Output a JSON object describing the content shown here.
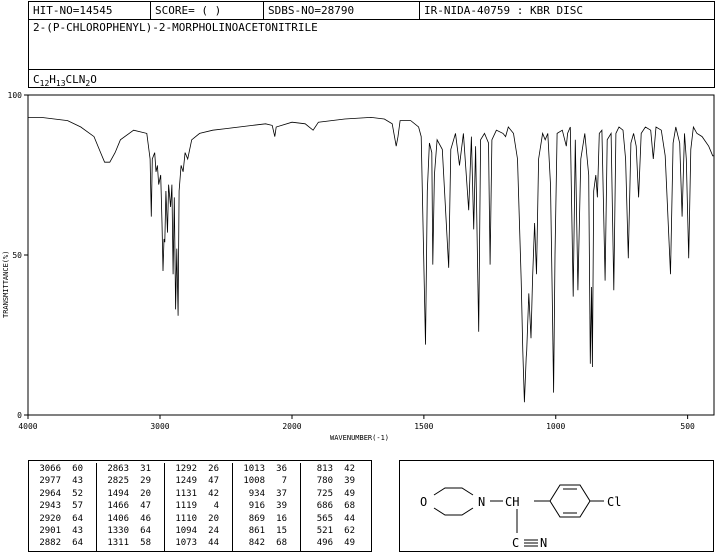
{
  "header": {
    "hit_no": "HIT-NO=14545",
    "score": "SCORE=  (  )",
    "sdbs_no": "SDBS-NO=28790",
    "ir_info": "IR-NIDA-40759 : KBR DISC"
  },
  "compound_name": "2-(P-CHLOROPHENYL)-2-MORPHOLINOACETONITRILE",
  "formula": {
    "c": "C",
    "c_n": "12",
    "h": "H",
    "h_n": "13",
    "cl": "CL",
    "n": "N",
    "n_n": "2",
    "o": "O"
  },
  "chart_data": {
    "type": "line",
    "xlabel": "WAVENUMBER(-1)",
    "ylabel": "TRANSMITTANCE(%)",
    "xlim": [
      4000,
      400
    ],
    "ylim": [
      0,
      100
    ],
    "x_ticks": [
      4000,
      3000,
      2000,
      1500,
      1000,
      500
    ],
    "y_ticks": [
      0,
      50,
      100
    ],
    "grid": false,
    "series": [
      {
        "values": [
          [
            4000,
            93
          ],
          [
            3900,
            93
          ],
          [
            3800,
            92.5
          ],
          [
            3700,
            92
          ],
          [
            3600,
            90
          ],
          [
            3500,
            87
          ],
          [
            3450,
            82
          ],
          [
            3420,
            79
          ],
          [
            3380,
            79
          ],
          [
            3340,
            82
          ],
          [
            3300,
            86
          ],
          [
            3200,
            89
          ],
          [
            3100,
            88
          ],
          [
            3075,
            80
          ],
          [
            3066,
            62
          ],
          [
            3058,
            80
          ],
          [
            3040,
            82
          ],
          [
            3030,
            76
          ],
          [
            3020,
            78
          ],
          [
            3010,
            72
          ],
          [
            2995,
            75
          ],
          [
            2985,
            60
          ],
          [
            2977,
            45
          ],
          [
            2970,
            55
          ],
          [
            2964,
            54
          ],
          [
            2955,
            70
          ],
          [
            2943,
            57
          ],
          [
            2935,
            72
          ],
          [
            2920,
            65
          ],
          [
            2910,
            72
          ],
          [
            2901,
            44
          ],
          [
            2892,
            68
          ],
          [
            2882,
            33
          ],
          [
            2873,
            52
          ],
          [
            2863,
            31
          ],
          [
            2855,
            70
          ],
          [
            2840,
            78
          ],
          [
            2825,
            76
          ],
          [
            2810,
            82
          ],
          [
            2790,
            80
          ],
          [
            2760,
            86
          ],
          [
            2700,
            88
          ],
          [
            2600,
            89
          ],
          [
            2500,
            89.5
          ],
          [
            2400,
            90
          ],
          [
            2300,
            90.5
          ],
          [
            2200,
            91
          ],
          [
            2150,
            90.5
          ],
          [
            2130,
            87
          ],
          [
            2120,
            90
          ],
          [
            2000,
            91.5
          ],
          [
            1950,
            91
          ],
          [
            1920,
            89
          ],
          [
            1900,
            91.5
          ],
          [
            1800,
            92.5
          ],
          [
            1700,
            93
          ],
          [
            1650,
            92.5
          ],
          [
            1620,
            91
          ],
          [
            1605,
            84
          ],
          [
            1598,
            87
          ],
          [
            1590,
            92
          ],
          [
            1550,
            92
          ],
          [
            1520,
            90
          ],
          [
            1510,
            87
          ],
          [
            1494,
            22
          ],
          [
            1487,
            70
          ],
          [
            1479,
            85
          ],
          [
            1470,
            82
          ],
          [
            1466,
            47
          ],
          [
            1460,
            75
          ],
          [
            1450,
            86
          ],
          [
            1430,
            83
          ],
          [
            1406,
            46
          ],
          [
            1398,
            83
          ],
          [
            1380,
            88
          ],
          [
            1365,
            78
          ],
          [
            1350,
            88
          ],
          [
            1330,
            64
          ],
          [
            1320,
            87
          ],
          [
            1311,
            58
          ],
          [
            1304,
            84
          ],
          [
            1292,
            26
          ],
          [
            1285,
            86
          ],
          [
            1270,
            88
          ],
          [
            1255,
            85
          ],
          [
            1249,
            47
          ],
          [
            1242,
            86
          ],
          [
            1225,
            89
          ],
          [
            1200,
            88
          ],
          [
            1190,
            87
          ],
          [
            1180,
            90
          ],
          [
            1160,
            88
          ],
          [
            1145,
            80
          ],
          [
            1131,
            42
          ],
          [
            1125,
            20
          ],
          [
            1119,
            4
          ],
          [
            1112,
            18
          ],
          [
            1110,
            20
          ],
          [
            1102,
            38
          ],
          [
            1094,
            24
          ],
          [
            1088,
            42
          ],
          [
            1080,
            60
          ],
          [
            1073,
            44
          ],
          [
            1065,
            80
          ],
          [
            1050,
            88
          ],
          [
            1040,
            86
          ],
          [
            1030,
            88
          ],
          [
            1020,
            72
          ],
          [
            1013,
            36
          ],
          [
            1008,
            7
          ],
          [
            1003,
            50
          ],
          [
            995,
            88
          ],
          [
            975,
            89
          ],
          [
            960,
            84
          ],
          [
            955,
            88
          ],
          [
            945,
            90
          ],
          [
            934,
            37
          ],
          [
            926,
            86
          ],
          [
            916,
            39
          ],
          [
            905,
            80
          ],
          [
            890,
            88
          ],
          [
            875,
            75
          ],
          [
            869,
            16
          ],
          [
            864,
            40
          ],
          [
            861,
            15
          ],
          [
            856,
            70
          ],
          [
            848,
            75
          ],
          [
            842,
            68
          ],
          [
            835,
            88
          ],
          [
            825,
            89
          ],
          [
            813,
            42
          ],
          [
            805,
            86
          ],
          [
            790,
            88
          ],
          [
            780,
            39
          ],
          [
            772,
            88
          ],
          [
            760,
            90
          ],
          [
            745,
            89
          ],
          [
            735,
            80
          ],
          [
            725,
            49
          ],
          [
            715,
            85
          ],
          [
            705,
            88
          ],
          [
            695,
            84
          ],
          [
            686,
            68
          ],
          [
            676,
            88
          ],
          [
            660,
            90
          ],
          [
            640,
            89
          ],
          [
            630,
            80
          ],
          [
            620,
            90
          ],
          [
            600,
            89
          ],
          [
            585,
            81
          ],
          [
            565,
            44
          ],
          [
            555,
            85
          ],
          [
            545,
            90
          ],
          [
            530,
            85
          ],
          [
            521,
            62
          ],
          [
            512,
            88
          ],
          [
            505,
            80
          ],
          [
            496,
            49
          ],
          [
            488,
            83
          ],
          [
            478,
            90
          ],
          [
            465,
            88
          ],
          [
            445,
            87
          ],
          [
            420,
            84
          ],
          [
            405,
            81
          ],
          [
            400,
            81
          ]
        ]
      }
    ]
  },
  "peak_table": [
    [
      [
        "3066",
        "60"
      ],
      [
        "2977",
        "43"
      ],
      [
        "2964",
        "52"
      ],
      [
        "2943",
        "57"
      ],
      [
        "2920",
        "64"
      ],
      [
        "2901",
        "43"
      ],
      [
        "2882",
        "64"
      ]
    ],
    [
      [
        "2863",
        "31"
      ],
      [
        "2825",
        "29"
      ],
      [
        "1494",
        "20"
      ],
      [
        "1466",
        "47"
      ],
      [
        "1406",
        "46"
      ],
      [
        "1330",
        "64"
      ],
      [
        "1311",
        "58"
      ]
    ],
    [
      [
        "1292",
        "26"
      ],
      [
        "1249",
        "47"
      ],
      [
        "1131",
        "42"
      ],
      [
        "1119",
        "4"
      ],
      [
        "1110",
        "20"
      ],
      [
        "1094",
        "24"
      ],
      [
        "1073",
        "44"
      ]
    ],
    [
      [
        "1013",
        "36"
      ],
      [
        "1008",
        "7"
      ],
      [
        "934",
        "37"
      ],
      [
        "916",
        "39"
      ],
      [
        "869",
        "16"
      ],
      [
        "861",
        "15"
      ],
      [
        "842",
        "68"
      ]
    ],
    [
      [
        "813",
        "42"
      ],
      [
        "780",
        "39"
      ],
      [
        "725",
        "49"
      ],
      [
        "686",
        "68"
      ],
      [
        "565",
        "44"
      ],
      [
        "521",
        "62"
      ],
      [
        "496",
        "49"
      ]
    ]
  ],
  "structure": {
    "o": "O",
    "n": "N",
    "ch": "CH",
    "cl": "Cl",
    "nitrile_c": "C",
    "nitrile_n": "N",
    "icon": "molecule-structure-icon"
  }
}
